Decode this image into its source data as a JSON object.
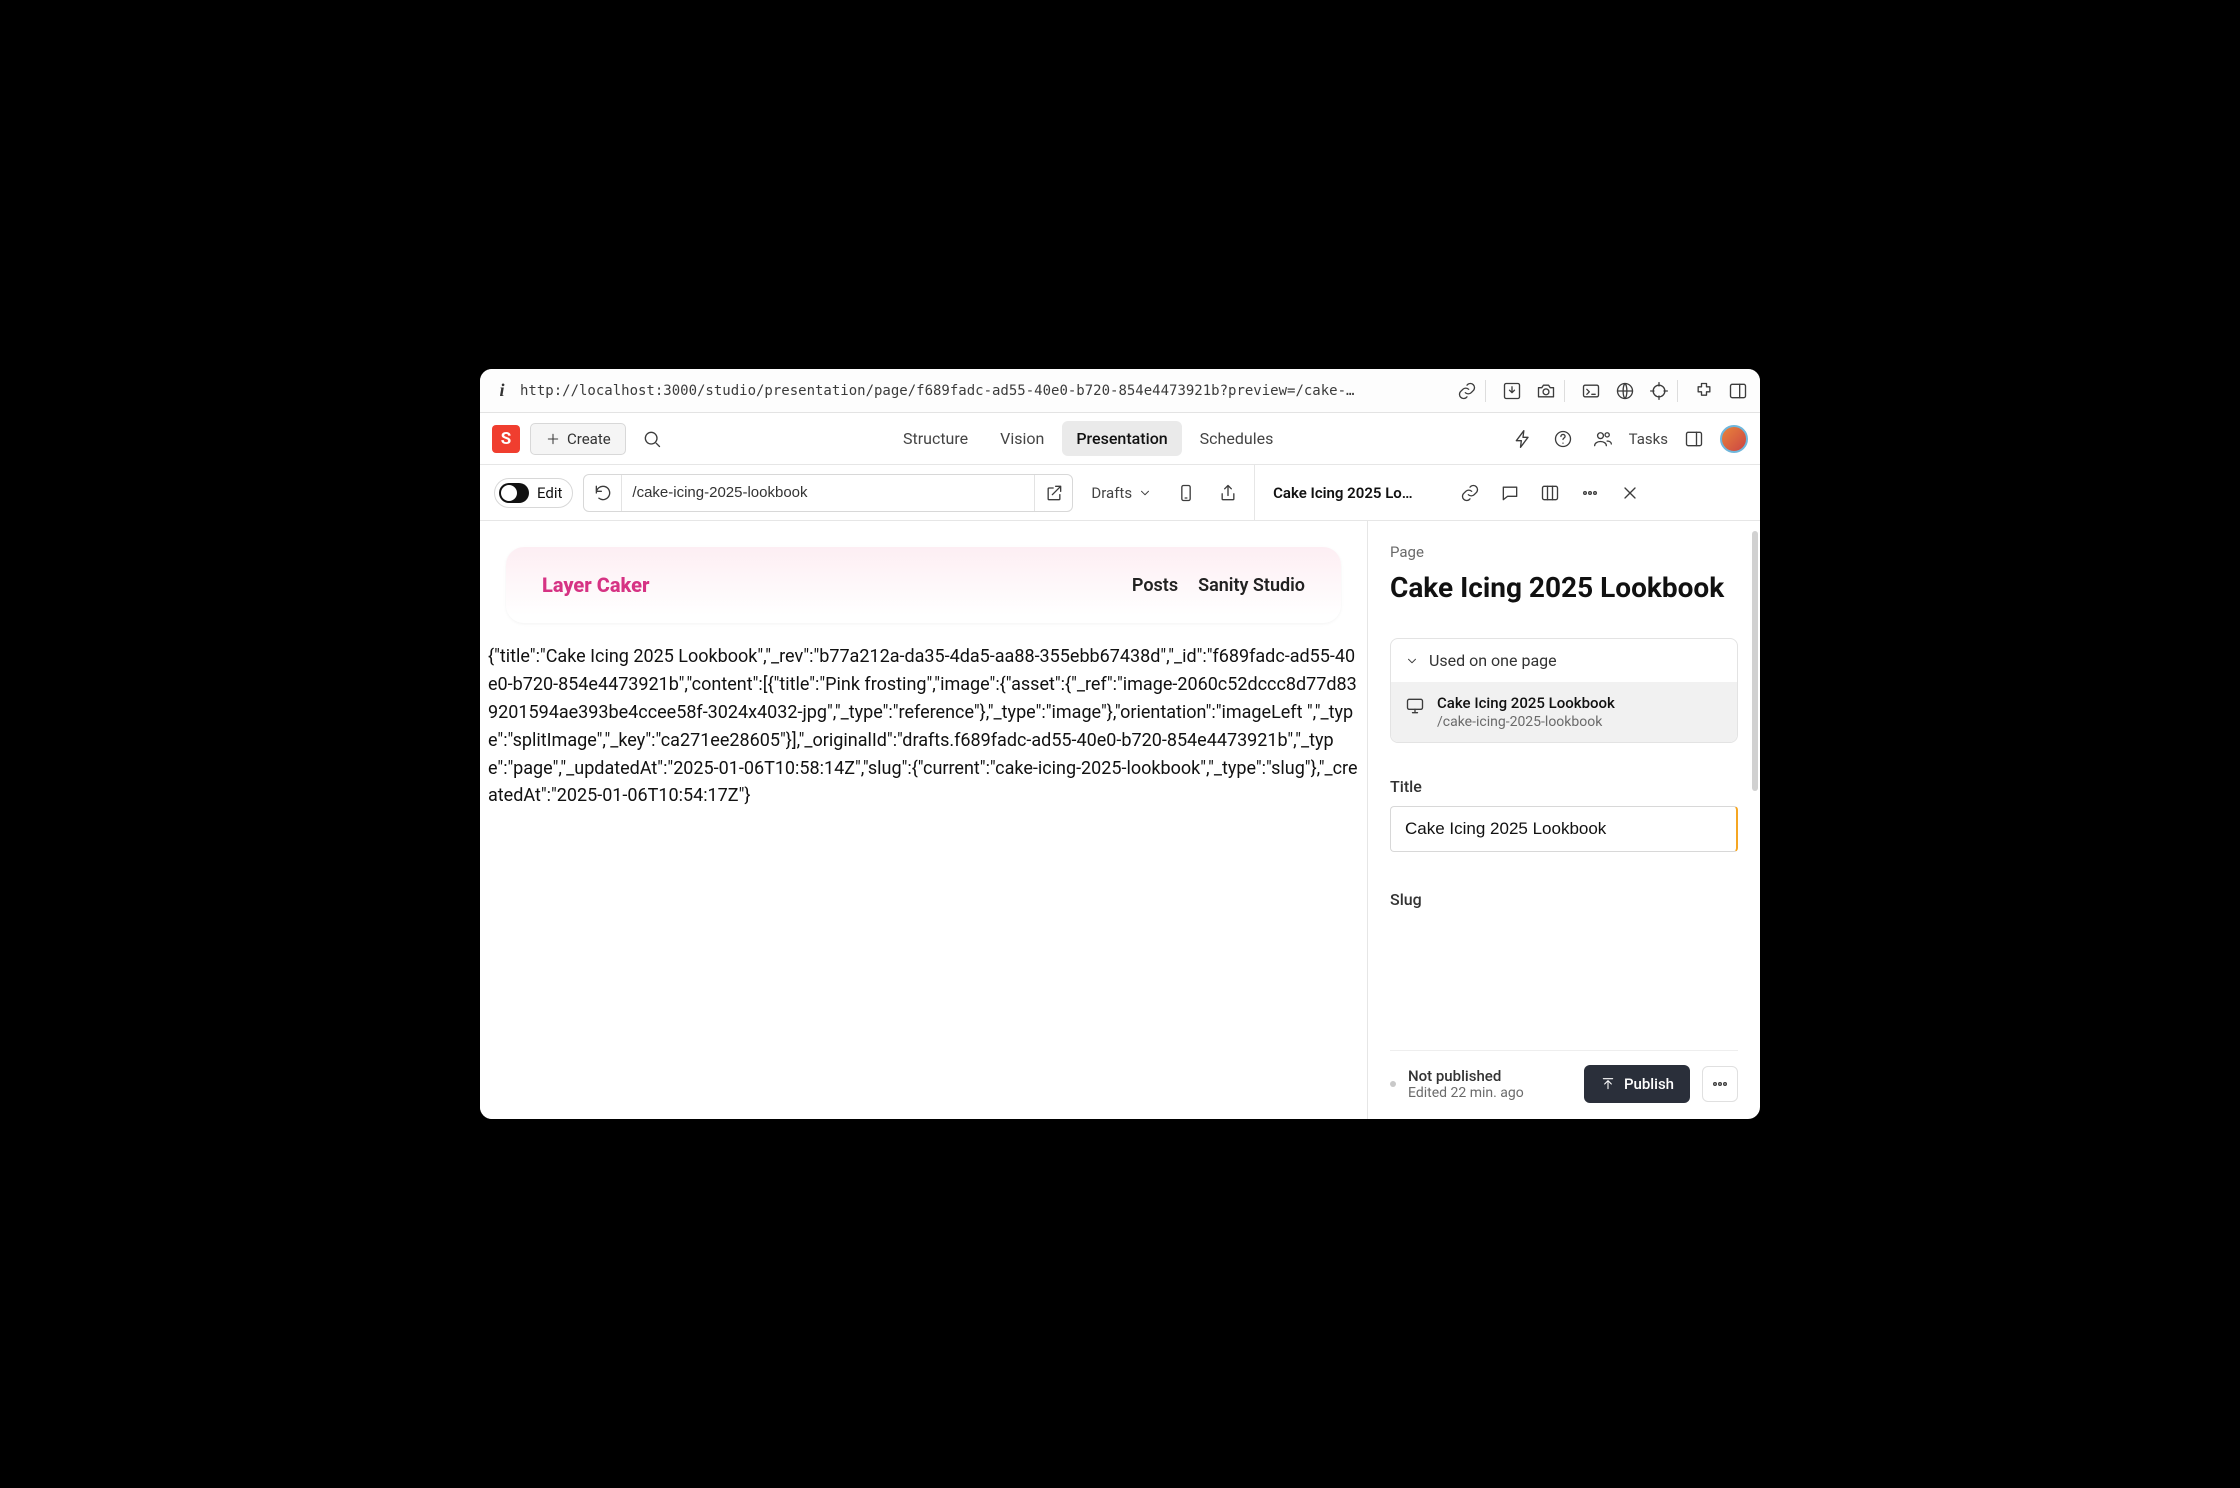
{
  "browser": {
    "url": "http://localhost:3000/studio/presentation/page/f689fadc-ad55-40e0-b720-854e4473921b?preview=/cake-…"
  },
  "topnav": {
    "logo_letter": "S",
    "create_label": "Create",
    "tabs": [
      "Structure",
      "Vision",
      "Presentation",
      "Schedules"
    ],
    "active_tab_index": 2,
    "tasks_label": "Tasks"
  },
  "toolbar": {
    "edit_label": "Edit",
    "path": "/cake-icing-2025-lookbook",
    "drafts_label": "Drafts"
  },
  "preview": {
    "brand": "Layer Caker",
    "nav": [
      "Posts",
      "Sanity Studio"
    ],
    "json_text": "{\"title\":\"Cake Icing 2025 Lookbook\",\"_rev\":\"b77a212a-da35-4da5-aa88-355ebb67438d\",\"_id\":\"f689fadc-ad55-40e0-b720-854e4473921b\",\"content\":[{\"title\":\"Pink frosting\",\"image\":{\"asset\":{\"_ref\":\"image-2060c52dccc8d77d839201594ae393be4ccee58f-3024x4032-jpg\",\"_type\":\"reference\"},\"_type\":\"image\"},\"orientation\":\"imageLeft \",\"_type\":\"splitImage\",\"_key\":\"ca271ee28605\"}],\"_originalId\":\"drafts.f689fadc-ad55-40e0-b720-854e4473921b\",\"_type\":\"page\",\"_updatedAt\":\"2025-01-06T10:58:14Z\",\"slug\":{\"current\":\"cake-icing-2025-lookbook\",\"_type\":\"slug\"},\"_createdAt\":\"2025-01-06T10:54:17Z\"}"
  },
  "panel": {
    "header_title": "Cake Icing 2025 Lo…",
    "doc_type": "Page",
    "doc_title": "Cake Icing 2025 Lookbook",
    "used_on_label": "Used on one page",
    "used_row_title": "Cake Icing 2025 Lookbook",
    "used_row_path": "/cake-icing-2025-lookbook",
    "title_field_label": "Title",
    "title_field_value": "Cake Icing 2025 Lookbook",
    "slug_field_label": "Slug",
    "status_not_published": "Not published",
    "status_edited": "Edited 22 min. ago",
    "publish_label": "Publish"
  }
}
